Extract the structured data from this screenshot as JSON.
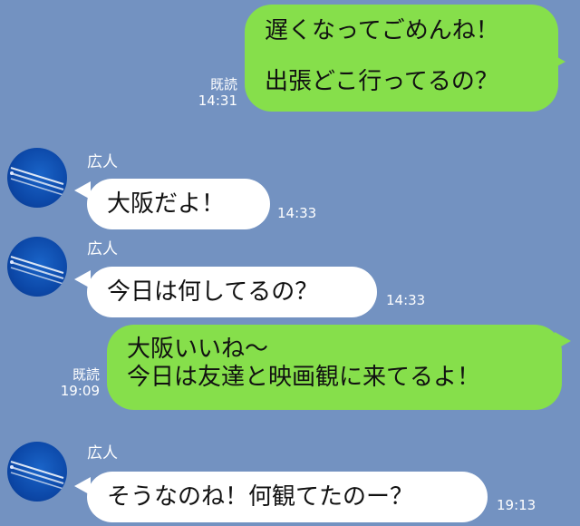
{
  "messages": [
    {
      "side": "me",
      "lines": [
        "遅くなってごめんね！",
        "出張どこ行ってるの？"
      ],
      "read": "既読",
      "time": "14:31"
    },
    {
      "side": "them",
      "sender": "広人",
      "lines": [
        "大阪だよ！"
      ],
      "time": "14:33"
    },
    {
      "side": "them",
      "sender": "広人",
      "lines": [
        "今日は何してるの？"
      ],
      "time": "14:33"
    },
    {
      "side": "me",
      "lines": [
        "大阪いいね〜",
        "今日は友達と映画観に来てるよ！"
      ],
      "read": "既読",
      "time": "19:09"
    },
    {
      "side": "them",
      "sender": "広人",
      "lines": [
        "そうなのね！何観てたのー？"
      ],
      "time": "19:13"
    }
  ],
  "colors": {
    "background": "#7392c1",
    "my_bubble": "#86df4b",
    "their_bubble": "#ffffff",
    "avatar": "#0c48a8"
  },
  "icons": {
    "avatar": "sky-contrail-avatar"
  }
}
